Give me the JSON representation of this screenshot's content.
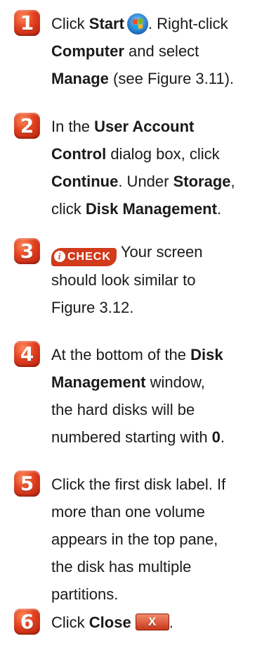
{
  "steps": [
    {
      "number": "1",
      "lines": {
        "l1_a": "Click ",
        "l1_b": "Start",
        "l1_c": ". Right-click",
        "l2_b": "Computer",
        "l2_c": " and select",
        "l3_b": "Manage",
        "l3_c": " (see Figure 3.11)."
      }
    },
    {
      "number": "2",
      "lines": {
        "l1_a": "In the ",
        "l1_b": "User Account",
        "l2_b": "Control",
        "l2_c": " dialog box, click",
        "l3_b": "Continue",
        "l3_c": ". Under ",
        "l3_d": "Storage",
        "l3_e": ",",
        "l4_a": "click ",
        "l4_b": "Disk Management",
        "l4_c": "."
      }
    },
    {
      "number": "3",
      "check_label": "CHECK",
      "check_i": "i",
      "lines": {
        "l1": "Your screen",
        "l2": "should look similar to",
        "l3": "Figure 3.12."
      }
    },
    {
      "number": "4",
      "lines": {
        "l1_a": "At the bottom of the ",
        "l1_b": "Disk",
        "l2_b": "Management",
        "l2_c": " window,",
        "l3": "the hard disks will be",
        "l4_a": "numbered starting with ",
        "l4_b": "0",
        "l4_c": "."
      }
    },
    {
      "number": "5",
      "lines": {
        "l1": "Click the first disk label. If",
        "l2": "more than one volume",
        "l3": "appears in the top pane,",
        "l4": "the disk has multiple",
        "l5": "partitions."
      }
    },
    {
      "number": "6",
      "close_x": "X",
      "lines": {
        "l1_a": "Click ",
        "l1_b": "Close",
        "l1_c": "."
      }
    }
  ]
}
